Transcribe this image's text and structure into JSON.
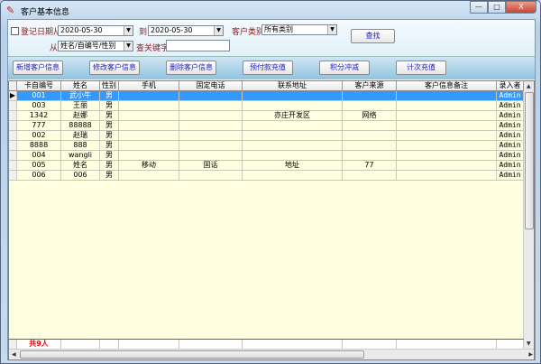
{
  "window": {
    "title": "客户基本信息",
    "minimize": "—",
    "maximize": "□",
    "close": "X"
  },
  "filters": {
    "date_from_label": "登记日期从",
    "date_from": "2020-05-30",
    "date_to_label": "到",
    "date_to": "2020-05-30",
    "category_label": "客户类别",
    "category": "所有类别",
    "search_button": "查找",
    "from_label": "从",
    "field_select": "姓名/自编号/性别",
    "keyword_label": "查关键字",
    "keyword": ""
  },
  "buttons": [
    "新增客户信息",
    "修改客户信息",
    "删除客户信息",
    "预付款充值",
    "积分冲减",
    "计次充值"
  ],
  "table": {
    "columns": [
      "卡自编号",
      "姓名",
      "性别",
      "手机",
      "固定电话",
      "联系地址",
      "客户来源",
      "客户信息备注",
      "录入者"
    ],
    "rows": [
      [
        "001",
        "武小牛",
        "男",
        "",
        "",
        "",
        "",
        "",
        "Admin"
      ],
      [
        "003",
        "王丽",
        "男",
        "",
        "",
        "",
        "",
        "",
        "Admin"
      ],
      [
        "1342",
        "赵娜",
        "男",
        "",
        "",
        "亦庄开发区",
        "网络",
        "",
        "Admin"
      ],
      [
        "777",
        "88888",
        "男",
        "",
        "",
        "",
        "",
        "",
        "Admin"
      ],
      [
        "002",
        "赵瑞",
        "男",
        "",
        "",
        "",
        "",
        "",
        "Admin"
      ],
      [
        "8888",
        "888",
        "男",
        "",
        "",
        "",
        "",
        "",
        "Admin"
      ],
      [
        "004",
        "wangli",
        "男",
        "",
        "",
        "",
        "",
        "",
        "Admin"
      ],
      [
        "005",
        "姓名",
        "男",
        "移动",
        "固话",
        "地址",
        "77",
        "",
        "Admin"
      ],
      [
        "006",
        "006",
        "男",
        "",
        "",
        "",
        "",
        "",
        "Admin"
      ]
    ],
    "selected_row": 0,
    "footer_count": "共9人"
  }
}
